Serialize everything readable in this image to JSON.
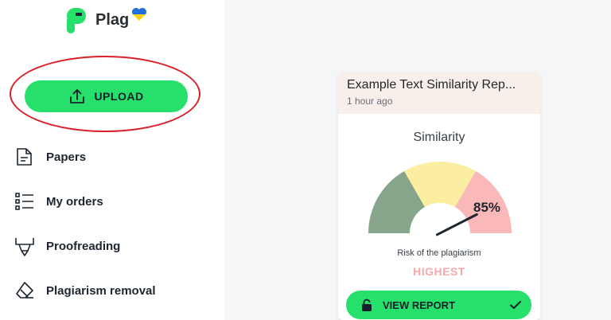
{
  "brand": {
    "name": "Plag"
  },
  "sidebar": {
    "upload_label": "UPLOAD",
    "items": [
      {
        "label": "Papers",
        "icon": "document-icon"
      },
      {
        "label": "My orders",
        "icon": "list-icon"
      },
      {
        "label": "Proofreading",
        "icon": "proofreading-icon"
      },
      {
        "label": "Plagiarism removal",
        "icon": "eraser-icon"
      }
    ]
  },
  "report_card": {
    "title": "Example Text Similarity Rep...",
    "time": "1 hour ago",
    "similarity_label": "Similarity",
    "similarity_value": "85%",
    "similarity_percent": 85,
    "risk_label": "Risk of the plagiarism",
    "risk_level": "HIGHEST",
    "view_label": "VIEW REPORT"
  },
  "colors": {
    "accent": "#26e06b",
    "gauge_low": "#86a58a",
    "gauge_mid": "#fbeea0",
    "gauge_high": "#fbb8b8",
    "risk_text": "#f5a8a8",
    "annotation_ring": "#d9202a"
  }
}
